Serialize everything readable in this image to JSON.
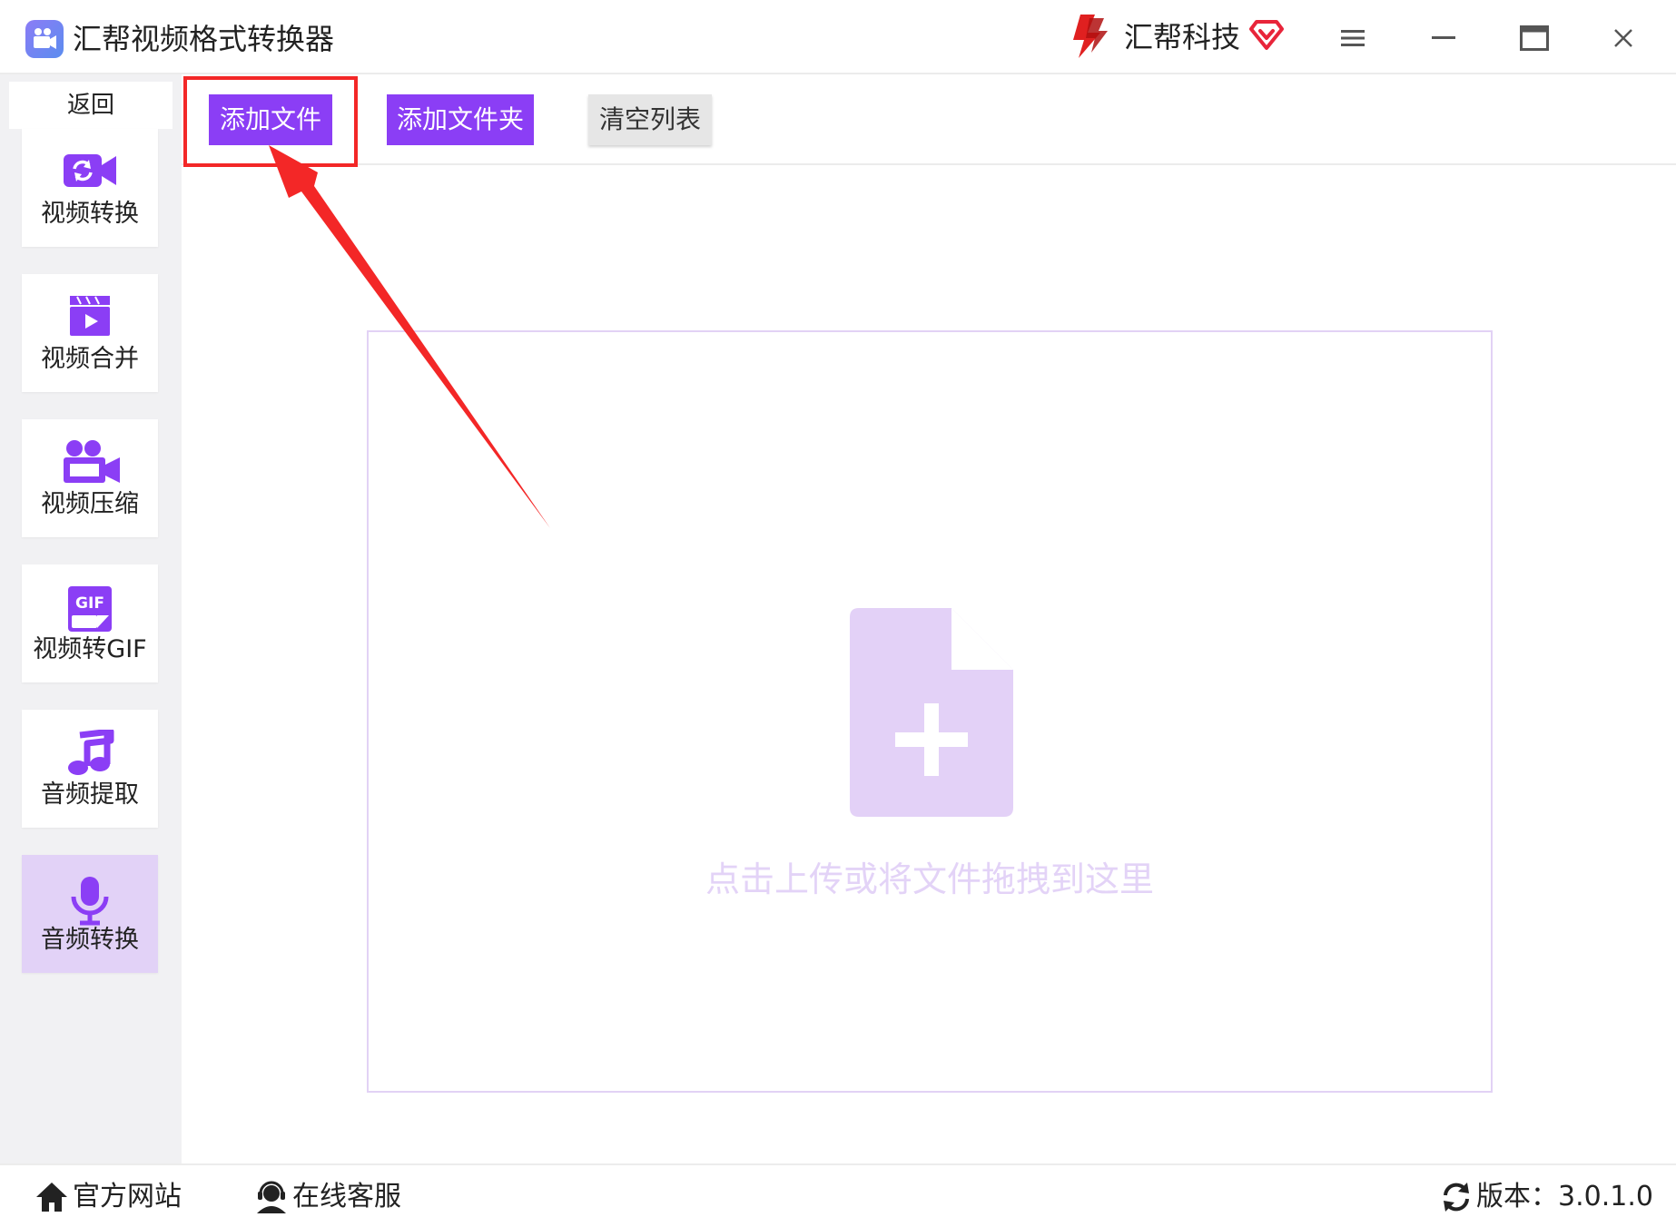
{
  "titlebar": {
    "app_title": "汇帮视频格式转换器",
    "brand_name": "汇帮科技"
  },
  "sidebar": {
    "back_label": "返回",
    "items": [
      {
        "label": "视频转换",
        "icon": "video-convert-icon"
      },
      {
        "label": "视频合并",
        "icon": "video-merge-icon"
      },
      {
        "label": "视频压缩",
        "icon": "video-compress-icon"
      },
      {
        "label": "视频转GIF",
        "icon": "gif-icon"
      },
      {
        "label": "音频提取",
        "icon": "music-note-icon"
      },
      {
        "label": "音频转换",
        "icon": "microphone-icon",
        "active": true
      }
    ]
  },
  "toolbar": {
    "add_file_label": "添加文件",
    "add_folder_label": "添加文件夹",
    "clear_list_label": "清空列表"
  },
  "drop_zone": {
    "hint": "点击上传或将文件拖拽到这里"
  },
  "statusbar": {
    "website_label": "官方网站",
    "service_label": "在线客服",
    "version_label": "版本：3.0.1.0"
  },
  "colors": {
    "accent": "#8b3ef5",
    "active_nav_bg": "#e2d2f7",
    "annotation_red": "#f32727",
    "drop_hint": "#e3d3f7"
  }
}
